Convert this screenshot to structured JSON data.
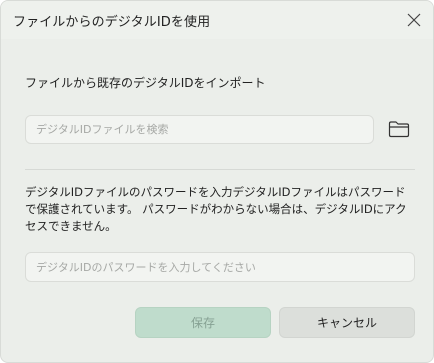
{
  "dialog": {
    "title": "ファイルからのデジタルIDを使用",
    "close_icon": "close-icon"
  },
  "import_section": {
    "label": "ファイルから既存のデジタルIDをインポート",
    "file_placeholder": "デジタルIDファイルを検索",
    "folder_icon": "folder-icon"
  },
  "password_section": {
    "description": "デジタルIDファイルのパスワードを入力デジタルIDファイルはパスワードで保護されています。 パスワードがわからない場合は、デジタルIDにアクセスできません。",
    "password_placeholder": "デジタルIDのパスワードを入力してください"
  },
  "buttons": {
    "save_label": "保存",
    "save_state": "disabled",
    "cancel_label": "キャンセル"
  },
  "colors": {
    "background": "#ebeeea",
    "save_disabled_bg": "#bfdccc",
    "save_disabled_text": "#86a193",
    "cancel_bg": "#dcdfdb"
  }
}
